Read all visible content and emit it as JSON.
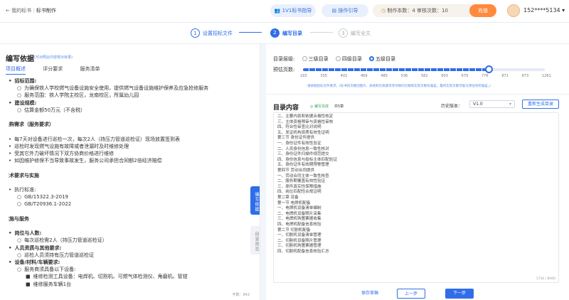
{
  "header": {
    "back": "← 我的标书",
    "title": "标书制作",
    "vip_btn": "1V1标书指导",
    "guide_btn": "操作引导",
    "counts": "制作本数：4  审核次数：10",
    "recharge": "充值",
    "user": "152****5134 ▾"
  },
  "steps": [
    {
      "num": "1",
      "label": "设置招标文件"
    },
    {
      "num": "2",
      "label": "编写目录"
    },
    {
      "num": "3",
      "label": "编写全文"
    }
  ],
  "left": {
    "title": "编写依据",
    "subtitle": "(可对照此内容核对目录)",
    "tabs": [
      "项目概述",
      "评分要求",
      "服务清单"
    ],
    "lines": [
      {
        "t": "招标范围:",
        "cls": "h",
        "ind": 0,
        "b": "•"
      },
      {
        "t": "为确保铁人学校燃气设备设施安全使用，提供燃气设备设施维护保养及应急抢修服务",
        "cls": "",
        "ind": 1,
        "b": "○"
      },
      {
        "t": "服务范围：铁人学院主校区，龙南校区，所属幼儿园",
        "cls": "",
        "ind": 1,
        "b": "○"
      },
      {
        "t": "建设规模:",
        "cls": "h",
        "ind": 0,
        "b": "•"
      },
      {
        "t": "估算金额50万元（不含税）",
        "cls": "",
        "ind": 1,
        "b": "○"
      },
      {
        "t": "",
        "cls": "",
        "ind": 0,
        "b": ""
      },
      {
        "t": "采购需求（服务要求）",
        "cls": "h",
        "ind": -1,
        "b": ""
      },
      {
        "t": "",
        "cls": "",
        "ind": 0,
        "b": ""
      },
      {
        "t": "每7天对设备进行巡检一次，每次2人（持压力管道巡检证）现场放置签到表",
        "cls": "",
        "ind": 0,
        "b": "•"
      },
      {
        "t": "巡检时发现燃气设施有故障或者泄漏时及时维修处理",
        "cls": "",
        "ind": 0,
        "b": "•"
      },
      {
        "t": "受其它外力破坏情况下双方协商价格进行维修",
        "cls": "",
        "ind": 0,
        "b": "•"
      },
      {
        "t": "如因维护修保不当导致事故发生，服务公司承担合同额2倍经济赔偿",
        "cls": "",
        "ind": 0,
        "b": "•"
      },
      {
        "t": "",
        "cls": "",
        "ind": 0,
        "b": ""
      },
      {
        "t": "技术要求与实施",
        "cls": "h",
        "ind": -1,
        "b": ""
      },
      {
        "t": "",
        "cls": "",
        "ind": 0,
        "b": ""
      },
      {
        "t": "执行标准:",
        "cls": "",
        "ind": 0,
        "b": "•"
      },
      {
        "t": "GB/15322.3-2019",
        "cls": "",
        "ind": 1,
        "b": "○"
      },
      {
        "t": "GB/T20936.1-2022",
        "cls": "",
        "ind": 1,
        "b": "○"
      },
      {
        "t": "",
        "cls": "",
        "ind": 0,
        "b": ""
      },
      {
        "t": "实施与服务",
        "cls": "h",
        "ind": -1,
        "b": ""
      },
      {
        "t": "",
        "cls": "",
        "ind": 0,
        "b": ""
      },
      {
        "t": "岗位与人数:",
        "cls": "h",
        "ind": 0,
        "b": "•"
      },
      {
        "t": "每次巡检需2人（持压力管道巡检证）",
        "cls": "",
        "ind": 1,
        "b": "○"
      },
      {
        "t": "人员资质与其他要求:",
        "cls": "h",
        "ind": 0,
        "b": "•"
      },
      {
        "t": "巡检人员须持有压力管道巡检证",
        "cls": "",
        "ind": 1,
        "b": "○"
      },
      {
        "t": "设备/材料/车辆要求:",
        "cls": "h",
        "ind": 0,
        "b": "•"
      },
      {
        "t": "服务商须具备以下设备:",
        "cls": "",
        "ind": 1,
        "b": "○"
      },
      {
        "t": "维修检测工具设备：电焊机、切割机、可燃气体检测仪、角磨机、管钳",
        "cls": "",
        "ind": 2,
        "b": "■"
      },
      {
        "t": "维修服务车辆1台",
        "cls": "",
        "ind": 2,
        "b": "■"
      }
    ],
    "charcount": "字数：842",
    "side_tab_active": "编写依据",
    "side_tab_inactive": "目录预览"
  },
  "right": {
    "level_label": "目录层级:",
    "levels": [
      "三级目录",
      "四级目录",
      "五级目录"
    ],
    "selected_level_index": 2,
    "pages_label": "预估页数:",
    "ticks": [
      "193",
      "335",
      "402",
      "469",
      "485",
      "536",
      "582",
      "603",
      "679",
      "776",
      "871",
      "873",
      "1261"
    ],
    "slider_fraction": 0.77,
    "hint": "请依据招标文件要求，(标书的页数因图片、表格和页排版等等导致的页数和实际页数有偏差，最终实际页数可能与预估有所偏差。)",
    "toc_title": "目录内容",
    "toc_status": "◎ 编写完成",
    "toc_count": "共5章",
    "version_label": "历史版本：",
    "version_value": "V1.0",
    "regen": "重新生成目录",
    "toc_lines": [
      "二、主要内容和依据合格性核定",
      "三、主体资格预审与资格性审核",
      "四、符合性审查比对说明",
      "五、发证机构资质有效性证明",
      "第三节 身份证件提供",
      "一、身份证件有效性验证",
      "二、人员身份信息一致性核对",
      "三、身份证件扫描件规范提交",
      "四、身份信息与投标主体匹配验证",
      "五、身份证件有效期预警管理",
      "第四节 劳动合同提供",
      "一、劳动合同主体一致性核查",
      "二、服务期覆盖有效性验证",
      "三、原件真实性保障措施",
      "四、岗位匹配性合规证明",
      "第二章 设备",
      "第一节 电焊机配备",
      "一、电焊机设备清单编制",
      "二、电焊机设备照片采集",
      "三、电焊机购置票据收集",
      "四、电焊机配备信息核验",
      "第二节 切割机配备",
      "一、切割机设备清单管理",
      "二、切割机设备照片管理",
      "三、切割机购置票据管理",
      "四、切割机配备信息核验汇总"
    ],
    "toc_counter": "1716 / 8000",
    "save": "保存草稿",
    "prev": "上一步",
    "next": "下一步"
  }
}
